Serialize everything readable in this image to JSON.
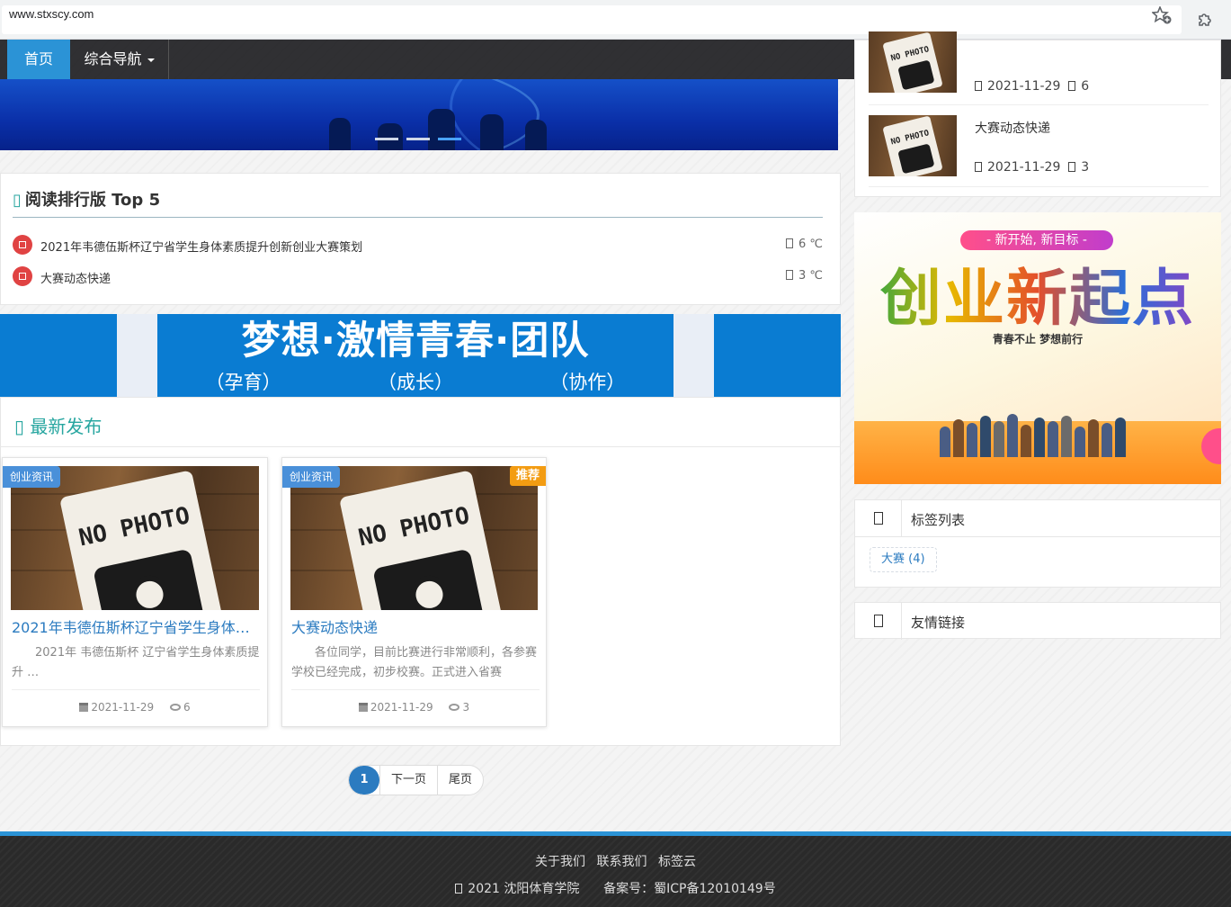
{
  "browser": {
    "url": "www.stxscy.com"
  },
  "nav": {
    "home": "首页",
    "guide": "综合导航"
  },
  "rank": {
    "title": "阅读排行版 Top 5",
    "items": [
      {
        "title": "2021年韦德伍斯杯辽宁省学生身体素质提升创新创业大赛策划",
        "temp": "6 ℃"
      },
      {
        "title": "大赛动态快递",
        "temp": "3 ℃"
      }
    ]
  },
  "motto": {
    "main": "梦想·激情青春·团队",
    "subs": [
      "（孕育）",
      "（成长）",
      "（协作）"
    ]
  },
  "latest": {
    "title": "最新发布",
    "cards": [
      {
        "category": "创业资讯",
        "recommended": "",
        "title": "2021年韦德伍斯杯辽宁省学生身体…",
        "desc": "2021年 韦德伍斯杯 辽宁省学生身体素质提升 …",
        "date": "2021-11-29",
        "views": "6",
        "photo_text": "NO PHOTO"
      },
      {
        "category": "创业资讯",
        "recommended": "推荐",
        "title": "大赛动态快递",
        "desc": "各位同学，目前比赛进行非常顺利，各参赛学校已经完成，初步校赛。正式进入省赛",
        "date": "2021-11-29",
        "views": "3",
        "photo_text": "NO PHOTO"
      }
    ]
  },
  "pagination": {
    "current": "1",
    "next": "下一页",
    "last": "尾页"
  },
  "sidebar": {
    "recent": [
      {
        "title": "",
        "date": "2021-11-29",
        "views": "6"
      },
      {
        "title": "大赛动态快递",
        "date": "2021-11-29",
        "views": "3"
      }
    ],
    "poster": {
      "ribbon": "- 新开始, 新目标 -",
      "title": "创业新起点",
      "sub": "青春不止 梦想前行"
    },
    "tags_title": "标签列表",
    "tags": [
      {
        "label": "大赛 (4)"
      }
    ],
    "links_title": "友情链接"
  },
  "footer": {
    "links": [
      "关于我们",
      "联系我们",
      "标签云"
    ],
    "copyright": "2021 沈阳体育学院",
    "icp": "备案号：蜀ICP备12010149号"
  },
  "colors": {
    "accent": "#2b93d6",
    "teal": "#27a6a0",
    "link": "#2b7bc0",
    "rank_badge": "#e04343",
    "recommend": "#f39c12"
  }
}
